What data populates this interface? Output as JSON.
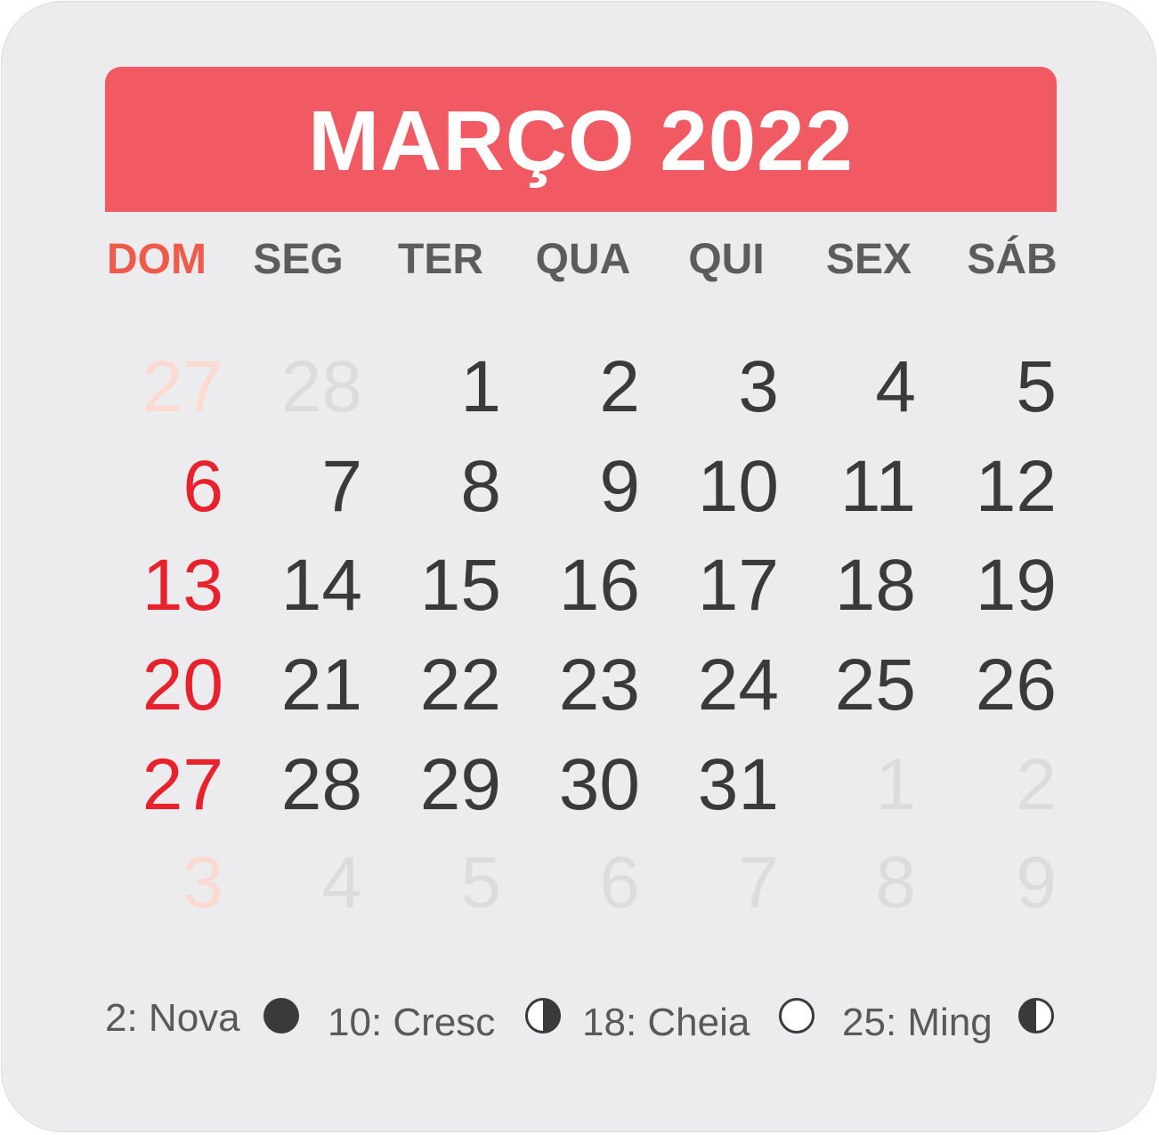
{
  "header": {
    "title": "MARÇO 2022"
  },
  "weekdays": [
    "DOM",
    "SEG",
    "TER",
    "QUA",
    "QUI",
    "SEX",
    "SÁB"
  ],
  "weeks": [
    [
      {
        "d": "27",
        "s": "faded-sun"
      },
      {
        "d": "28",
        "s": "faded"
      },
      {
        "d": "1",
        "s": "normal"
      },
      {
        "d": "2",
        "s": "normal"
      },
      {
        "d": "3",
        "s": "normal"
      },
      {
        "d": "4",
        "s": "normal"
      },
      {
        "d": "5",
        "s": "normal"
      }
    ],
    [
      {
        "d": "6",
        "s": "sun"
      },
      {
        "d": "7",
        "s": "normal"
      },
      {
        "d": "8",
        "s": "normal"
      },
      {
        "d": "9",
        "s": "normal"
      },
      {
        "d": "10",
        "s": "normal"
      },
      {
        "d": "11",
        "s": "normal"
      },
      {
        "d": "12",
        "s": "normal"
      }
    ],
    [
      {
        "d": "13",
        "s": "sun"
      },
      {
        "d": "14",
        "s": "normal"
      },
      {
        "d": "15",
        "s": "normal"
      },
      {
        "d": "16",
        "s": "normal"
      },
      {
        "d": "17",
        "s": "normal"
      },
      {
        "d": "18",
        "s": "normal"
      },
      {
        "d": "19",
        "s": "normal"
      }
    ],
    [
      {
        "d": "20",
        "s": "sun"
      },
      {
        "d": "21",
        "s": "normal"
      },
      {
        "d": "22",
        "s": "normal"
      },
      {
        "d": "23",
        "s": "normal"
      },
      {
        "d": "24",
        "s": "normal"
      },
      {
        "d": "25",
        "s": "normal"
      },
      {
        "d": "26",
        "s": "normal"
      }
    ],
    [
      {
        "d": "27",
        "s": "sun"
      },
      {
        "d": "28",
        "s": "normal"
      },
      {
        "d": "29",
        "s": "normal"
      },
      {
        "d": "30",
        "s": "normal"
      },
      {
        "d": "31",
        "s": "normal"
      },
      {
        "d": "1",
        "s": "faded"
      },
      {
        "d": "2",
        "s": "faded"
      }
    ],
    [
      {
        "d": "3",
        "s": "faded-sun"
      },
      {
        "d": "4",
        "s": "faded"
      },
      {
        "d": "5",
        "s": "faded"
      },
      {
        "d": "6",
        "s": "faded"
      },
      {
        "d": "7",
        "s": "faded"
      },
      {
        "d": "8",
        "s": "faded"
      },
      {
        "d": "9",
        "s": "faded"
      }
    ]
  ],
  "legend": {
    "new_moon": {
      "label": "2: Nova",
      "icon": "new-moon-icon"
    },
    "first_quarter": {
      "label": "10: Cresc",
      "icon": "first-quarter-moon-icon"
    },
    "full_moon": {
      "label": "18: Cheia",
      "icon": "full-moon-icon"
    },
    "last_quarter": {
      "label": "25: Ming",
      "icon": "last-quarter-moon-icon"
    }
  },
  "colors": {
    "header_bg": "#f15a63",
    "card_bg": "#ececee",
    "sunday": "#e8222d",
    "weekday_sunday": "#ef5b4b",
    "text": "#3a3a3c",
    "faded": "#dcdcdd"
  }
}
